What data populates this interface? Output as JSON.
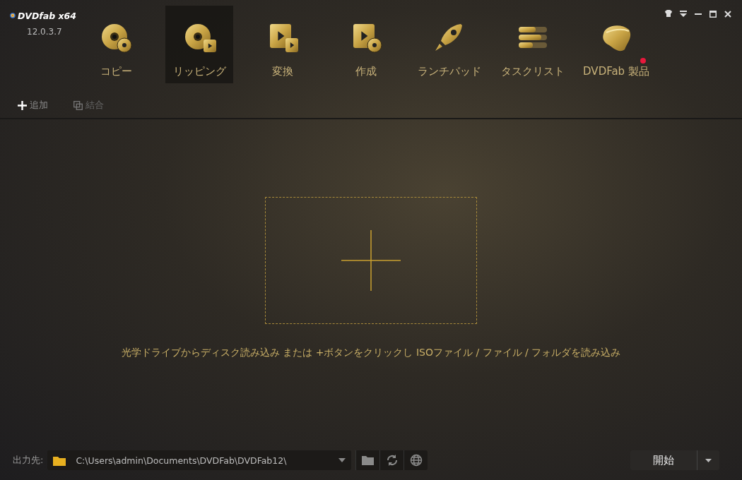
{
  "app": {
    "logo": "DVDfab x64",
    "version": "12.0.3.7"
  },
  "window_controls": [
    {
      "kind": "skin"
    },
    {
      "kind": "menu"
    },
    {
      "kind": "minimize"
    },
    {
      "kind": "maximize"
    },
    {
      "kind": "close"
    }
  ],
  "nav": [
    {
      "label": "コピー",
      "kind": "copy",
      "selected": false,
      "badge": false
    },
    {
      "label": "リッピング",
      "kind": "ripper",
      "selected": true,
      "badge": false
    },
    {
      "label": "変換",
      "kind": "convert",
      "selected": false,
      "badge": false
    },
    {
      "label": "作成",
      "kind": "create",
      "selected": false,
      "badge": false
    },
    {
      "label": "ランチパッド",
      "kind": "launchpad",
      "selected": false,
      "badge": false
    },
    {
      "label": "タスクリスト",
      "kind": "tasks",
      "selected": false,
      "badge": false
    },
    {
      "label": "DVDFab 製品",
      "kind": "products",
      "selected": false,
      "badge": true
    }
  ],
  "toolbar": [
    {
      "label": "追加",
      "kind": "add",
      "disabled": false
    },
    {
      "label": "結合",
      "kind": "merge",
      "disabled": true
    }
  ],
  "drop_zone": {
    "hint": "光学ドライブからディスク読み込み または +ボタンをクリックし ISOファイル / ファイル / フォルダを読み込み"
  },
  "output": {
    "label": "出力先:",
    "path": "C:\\Users\\admin\\Documents\\DVDFab\\DVDFab12\\"
  },
  "start_button": {
    "label": "開始"
  }
}
